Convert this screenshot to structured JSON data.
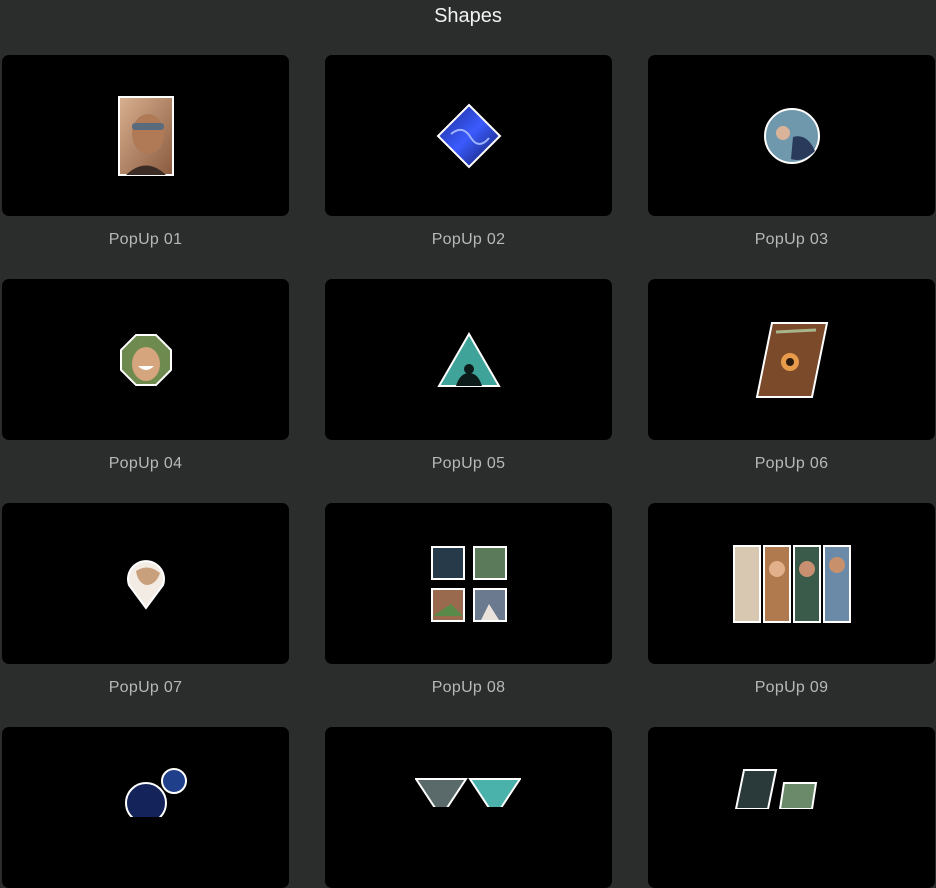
{
  "header": {
    "title": "Shapes"
  },
  "presets": [
    {
      "label": "PopUp 01",
      "icon": "rectangle-photo-icon"
    },
    {
      "label": "PopUp 02",
      "icon": "diamond-photo-icon"
    },
    {
      "label": "PopUp 03",
      "icon": "circle-photo-icon"
    },
    {
      "label": "PopUp 04",
      "icon": "octagon-photo-icon"
    },
    {
      "label": "PopUp 05",
      "icon": "triangle-photo-icon"
    },
    {
      "label": "PopUp 06",
      "icon": "parallelogram-photo-icon"
    },
    {
      "label": "PopUp 07",
      "icon": "teardrop-photo-icon"
    },
    {
      "label": "PopUp 08",
      "icon": "four-squares-photo-icon"
    },
    {
      "label": "PopUp 09",
      "icon": "four-strips-photo-icon"
    },
    {
      "label": "",
      "icon": "circles-photo-icon"
    },
    {
      "label": "",
      "icon": "triangles-photo-icon"
    },
    {
      "label": "",
      "icon": "slanted-panels-photo-icon"
    }
  ],
  "colors": {
    "background": "#2b2d2d",
    "card": "#000000",
    "label": "#b7b9b9",
    "frame": "#ffffff"
  }
}
